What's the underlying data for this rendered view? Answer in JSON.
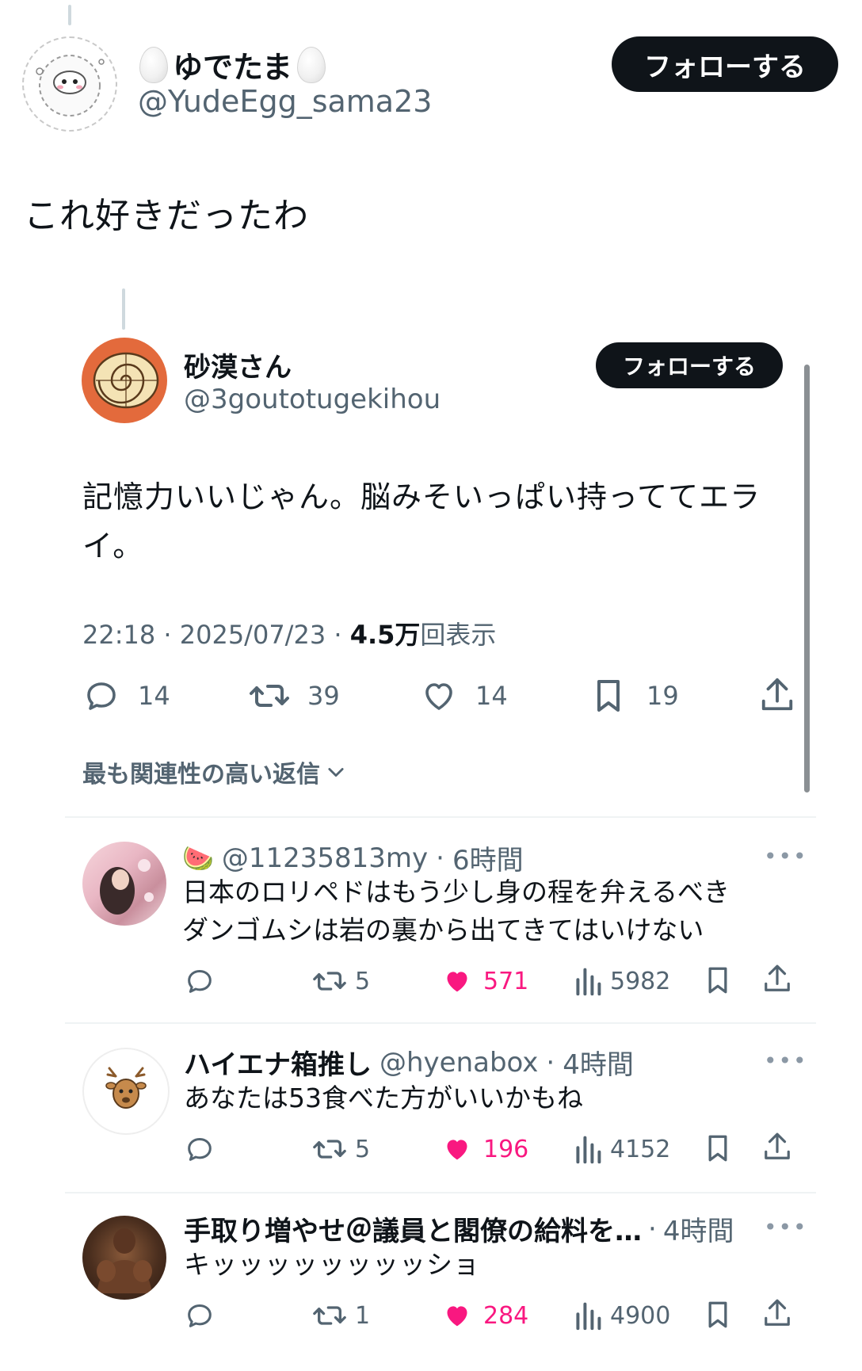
{
  "main_post": {
    "display_name": "ゆでたま",
    "handle": "@YudeEgg_sama23",
    "follow_label": "フォローする",
    "text": "これ好きだったわ"
  },
  "quoted_post": {
    "display_name": "砂漠さん",
    "handle": "@3goutotugekihou",
    "follow_label": "フォローする",
    "text_line1": "記憶力いいじゃん。脳みそいっぱい持っててエラ",
    "text_line2": "イ。",
    "time": "22:18",
    "date": "2025/07/23",
    "views_count": "4.5万",
    "views_label": "回表示",
    "stats": {
      "replies": "14",
      "reposts": "39",
      "likes": "14",
      "bookmarks": "19"
    },
    "sort_label": "最も関連性の高い返信"
  },
  "replies": [
    {
      "emoji": "🍉",
      "handle": "@11235813my",
      "time": "6時間",
      "line1": "日本のロリペドはもう少し身の程を弁えるべき",
      "line2": "ダンゴムシは岩の裏から出てきてはいけない",
      "reposts": "5",
      "likes": "571",
      "views": "5982"
    },
    {
      "display_name": "ハイエナ箱推し",
      "handle": "@hyenabox",
      "time": "4時間",
      "line1": "あなたは53食べた方がいいかもね",
      "reposts": "5",
      "likes": "196",
      "views": "4152"
    },
    {
      "display_name": "手取り増やせ＠議員と閣僚の給料を…",
      "time": "4時間",
      "line1": "キッッッッッッッッショ",
      "reposts": "1",
      "likes": "284",
      "views": "4900"
    }
  ],
  "colors": {
    "like_active": "#f91880",
    "muted": "#536471",
    "button_bg": "#0f1419"
  }
}
